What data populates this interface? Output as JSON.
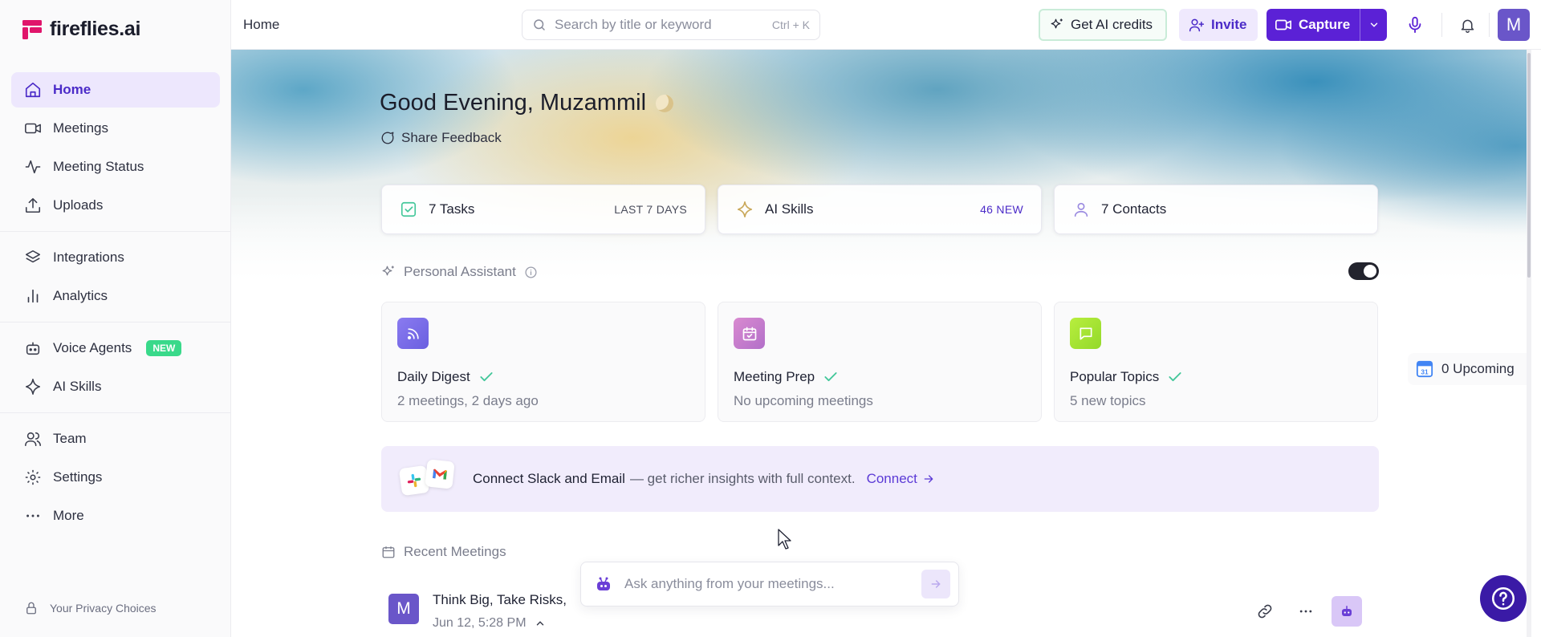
{
  "app": {
    "name": "fireflies.ai"
  },
  "sidebar": {
    "items": [
      {
        "label": "Home"
      },
      {
        "label": "Meetings"
      },
      {
        "label": "Meeting Status"
      },
      {
        "label": "Uploads"
      },
      {
        "label": "Integrations"
      },
      {
        "label": "Analytics"
      },
      {
        "label": "Voice Agents",
        "badge": "NEW"
      },
      {
        "label": "AI Skills"
      },
      {
        "label": "Team"
      },
      {
        "label": "Settings"
      },
      {
        "label": "More"
      }
    ],
    "privacy": "Your Privacy Choices"
  },
  "header": {
    "breadcrumb": "Home",
    "search": {
      "placeholder": "Search by title or keyword",
      "shortcut": "Ctrl + K"
    },
    "credits_label": "Get AI credits",
    "invite_label": "Invite",
    "capture_label": "Capture",
    "avatar_initial": "M"
  },
  "main": {
    "greeting": "Good Evening, Muzammil",
    "feedback": "Share Feedback",
    "stats": [
      {
        "label": "7 Tasks",
        "meta": "LAST 7 DAYS"
      },
      {
        "label": "AI Skills",
        "meta": "46 NEW"
      },
      {
        "label": "7 Contacts",
        "meta": ""
      }
    ],
    "assistant": {
      "title": "Personal Assistant",
      "enabled": true,
      "cards": [
        {
          "title": "Daily Digest",
          "subtitle": "2 meetings, 2 days ago",
          "icon": "rss-icon",
          "color": "#7b6fe6"
        },
        {
          "title": "Meeting Prep",
          "subtitle": "No upcoming meetings",
          "icon": "calendar-check-icon",
          "color": "#c86fc9"
        },
        {
          "title": "Popular Topics",
          "subtitle": "5 new topics",
          "icon": "chat-icon",
          "color": "#a6e33a"
        }
      ]
    },
    "upcoming": "0 Upcoming",
    "connect": {
      "strong": "Connect Slack and Email",
      "rest": "— get richer insights with full context.",
      "link": "Connect"
    },
    "recent": {
      "title": "Recent Meetings",
      "meetings": [
        {
          "avatar": "M",
          "title": "Think Big, Take Risks,",
          "date": "Jun 12, 5:28 PM"
        }
      ]
    },
    "ask": {
      "placeholder": "Ask anything from your meetings..."
    }
  },
  "colors": {
    "accent": "#5b21d6",
    "active_bg": "#ede7fd",
    "badge_new": "#39d98a"
  }
}
